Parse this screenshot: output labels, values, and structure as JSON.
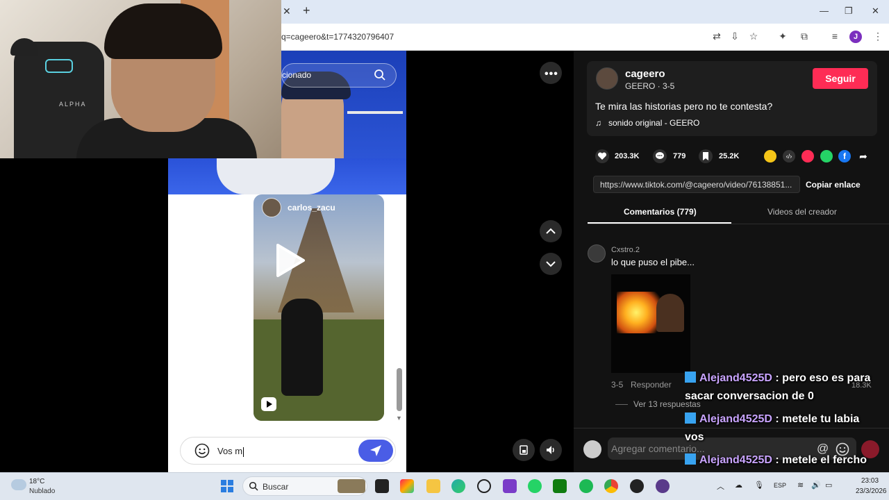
{
  "browser": {
    "url": "q=cageero&t=1774320796407"
  },
  "instagram": {
    "search_placeholder_fragment": "cionado",
    "reel_username": "carlos_zacu",
    "message_draft": "Vos m"
  },
  "post": {
    "username": "cageero",
    "subline": "GEERO · 3-5",
    "follow_label": "Seguir",
    "caption": "Te mira las historias pero no te contesta?",
    "sound": "sonido original - GEERO",
    "likes": "203.3K",
    "comments": "779",
    "saves": "25.2K",
    "link": "https://www.tiktok.com/@cageero/video/76138851...",
    "copy_label": "Copiar enlace",
    "colors": {
      "accent": "#fe2c55"
    }
  },
  "tabs": {
    "comments": "Comentarios (779)",
    "creator_videos": "Videos del creador"
  },
  "comment": {
    "user": "Cxstro.2",
    "text": "lo que puso el pibe...",
    "date": "3-5",
    "reply_label": "Responder",
    "likes": "18.3K",
    "view_replies": "Ver 13 respuestas"
  },
  "composer": {
    "placeholder": "Agregar comentario...",
    "at_symbol": "@"
  },
  "chat": [
    {
      "name": "Alejand4525D",
      "text": ": pero eso es para"
    },
    {
      "name": "",
      "text": "sacar conversacion de 0"
    },
    {
      "name": "Alejand4525D",
      "text": ": metele tu labia"
    },
    {
      "name": "",
      "text": "vos"
    },
    {
      "name": "Alejand4525D",
      "text": ": metele el fercho"
    }
  ],
  "webcam": {
    "chair_brand": "ALPHA"
  },
  "taskbar": {
    "temperature": "18°C",
    "condition": "Nublado",
    "search_label": "Buscar",
    "language": "ESP",
    "time": "23:03",
    "date": "23/3/2026"
  }
}
